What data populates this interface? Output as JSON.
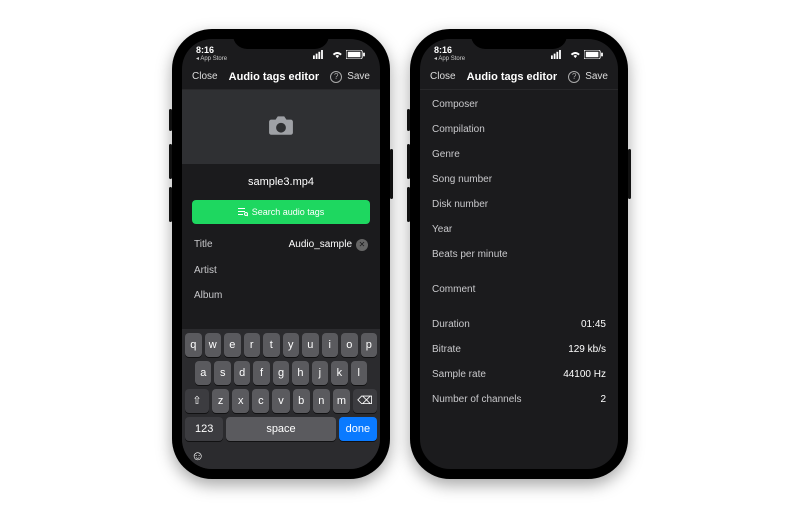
{
  "status": {
    "time": "8:16",
    "back": "◂ App Store"
  },
  "nav": {
    "close": "Close",
    "title": "Audio tags editor",
    "save": "Save"
  },
  "left": {
    "filename": "sample3.mp4",
    "search_btn": "Search audio tags",
    "fields": {
      "title_label": "Title",
      "title_value": "Audio_sample",
      "artist_label": "Artist",
      "album_label": "Album"
    }
  },
  "right": {
    "fields": {
      "composer": "Composer",
      "compilation": "Compilation",
      "genre": "Genre",
      "song_number": "Song number",
      "disk_number": "Disk number",
      "year": "Year",
      "bpm": "Beats per minute",
      "comment": "Comment",
      "duration_label": "Duration",
      "duration_value": "01:45",
      "bitrate_label": "Bitrate",
      "bitrate_value": "129 kb/s",
      "sample_rate_label": "Sample rate",
      "sample_rate_value": "44100 Hz",
      "channels_label": "Number of channels",
      "channels_value": "2"
    }
  },
  "keyboard": {
    "r1": [
      "q",
      "w",
      "e",
      "r",
      "t",
      "y",
      "u",
      "i",
      "o",
      "p"
    ],
    "r2": [
      "a",
      "s",
      "d",
      "f",
      "g",
      "h",
      "j",
      "k",
      "l"
    ],
    "r3": [
      "z",
      "x",
      "c",
      "v",
      "b",
      "n",
      "m"
    ],
    "num": "123",
    "space": "space",
    "done": "done"
  }
}
